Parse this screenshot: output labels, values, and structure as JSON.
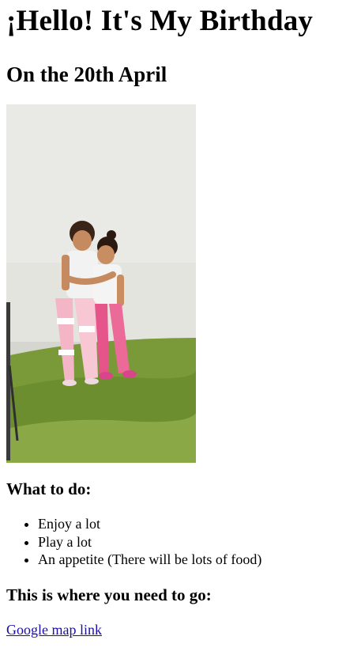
{
  "page": {
    "title": "¡Hello! It's My Birthday",
    "subtitle": "On the 20th April",
    "todo_heading": "What to do:",
    "todo_items": [
      "Enjoy a lot",
      "Play a lot",
      "An appetite (There will be lots of food)"
    ],
    "location_heading": "This is where you need to go:",
    "map_link_text": "Google map link"
  }
}
